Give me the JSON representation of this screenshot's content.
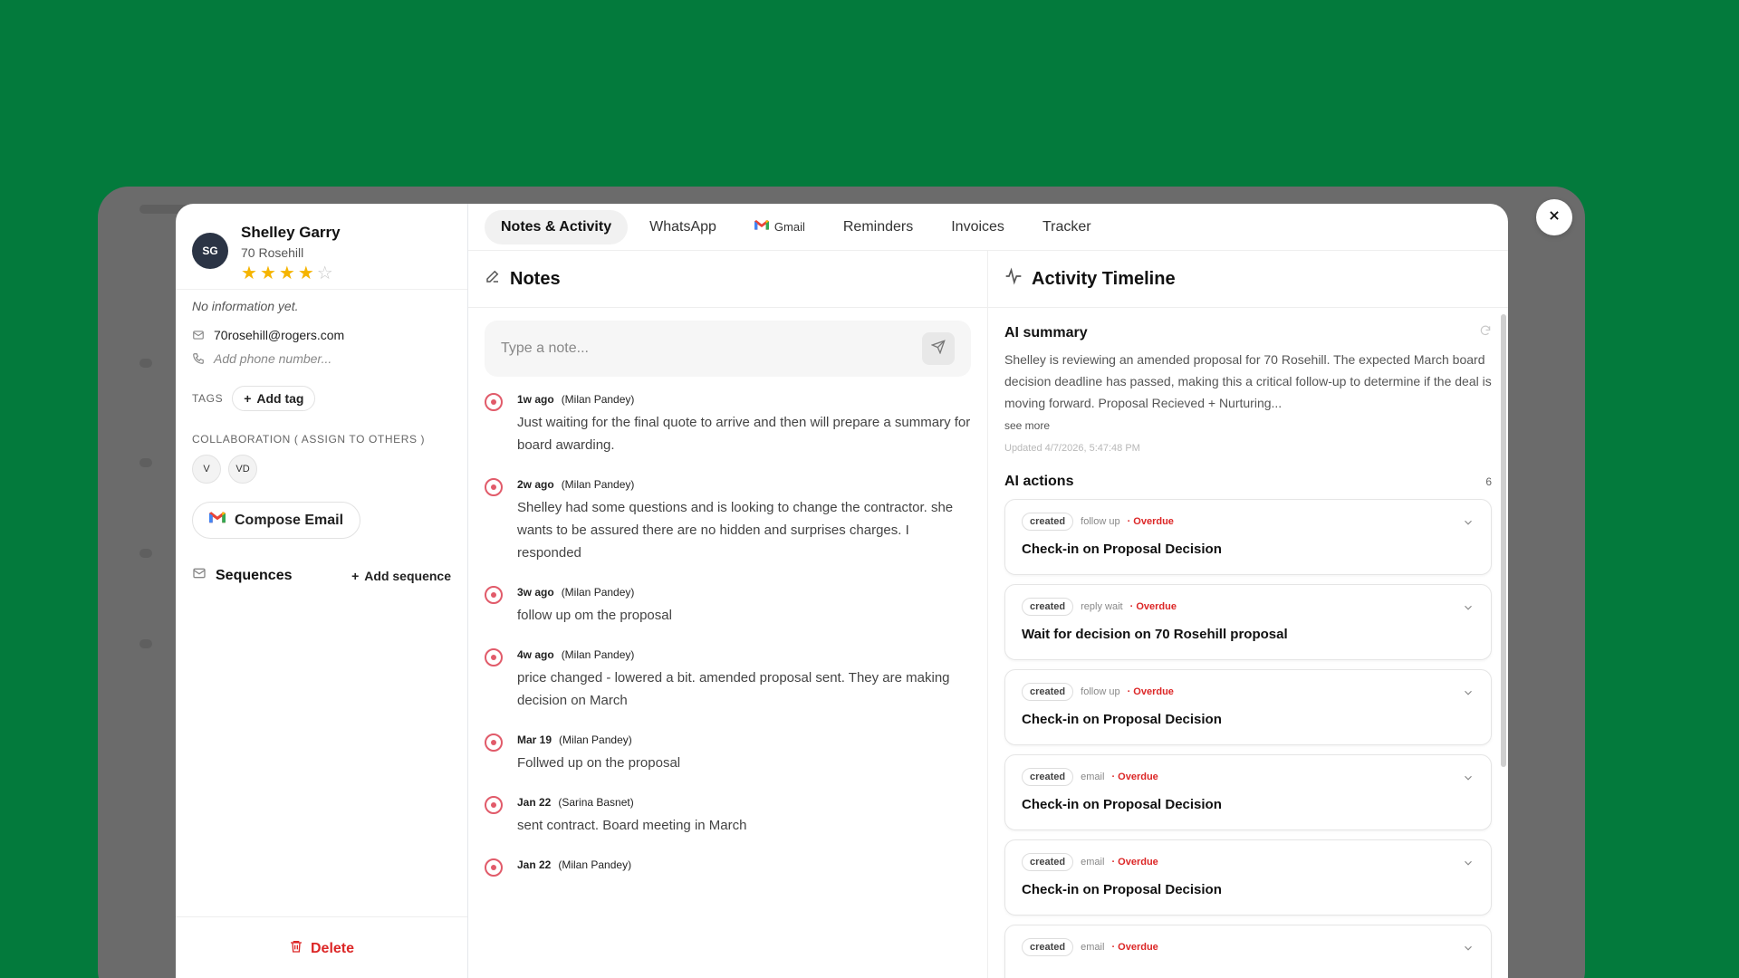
{
  "contact": {
    "initials": "SG",
    "name": "Shelley Garry",
    "subtitle": "70 Rosehill",
    "rating": 4,
    "no_info": "No information yet.",
    "email": "70rosehill@rogers.com",
    "phone_placeholder": "Add phone number..."
  },
  "tags": {
    "label": "TAGS",
    "add_label": "Add tag"
  },
  "collaboration": {
    "label": "COLLABORATION ( ASSIGN TO OTHERS )",
    "members": [
      "V",
      "VD"
    ]
  },
  "compose_label": "Compose Email",
  "sequences": {
    "label": "Sequences",
    "add_label": "Add sequence"
  },
  "delete_label": "Delete",
  "tabs": [
    {
      "label": "Notes & Activity",
      "active": true
    },
    {
      "label": "WhatsApp"
    },
    {
      "label": "Gmail"
    },
    {
      "label": "Reminders"
    },
    {
      "label": "Invoices"
    },
    {
      "label": "Tracker"
    }
  ],
  "notes": {
    "title": "Notes",
    "input_placeholder": "Type a note...",
    "items": [
      {
        "when": "1w ago",
        "author": "(Milan Pandey)",
        "text": "Just waiting for the final quote to arrive and then will prepare a summary for board awarding."
      },
      {
        "when": "2w ago",
        "author": "(Milan Pandey)",
        "text": "Shelley had some questions and is looking to change the contractor. she wants to be assured there are no hidden and surprises charges. I responded"
      },
      {
        "when": "3w ago",
        "author": "(Milan Pandey)",
        "text": "follow up om the proposal"
      },
      {
        "when": "4w ago",
        "author": "(Milan Pandey)",
        "text": "price changed - lowered a bit. amended proposal sent. They are making decision on March"
      },
      {
        "when": "Mar 19",
        "author": "(Milan Pandey)",
        "text": "Follwed up on the proposal"
      },
      {
        "when": "Jan 22",
        "author": "(Sarina Basnet)",
        "text": "sent contract. Board meeting in March"
      },
      {
        "when": "Jan 22",
        "author": "(Milan Pandey)",
        "text": ""
      }
    ]
  },
  "activity": {
    "title": "Activity Timeline",
    "ai_summary_title": "AI summary",
    "ai_summary_text": "Shelley is reviewing an amended proposal for 70 Rosehill. The expected March board decision deadline has passed, making this a critical follow-up to determine if the deal is moving forward. Proposal Recieved + Nurturing...",
    "see_more": "see more",
    "updated": "Updated 4/7/2026, 5:47:48 PM",
    "ai_actions_title": "AI actions",
    "ai_actions_count": "6",
    "actions": [
      {
        "status": "created",
        "kind": "follow up",
        "flag": "· Overdue",
        "title": "Check-in on Proposal Decision"
      },
      {
        "status": "created",
        "kind": "reply wait",
        "flag": "· Overdue",
        "title": "Wait for decision on 70 Rosehill proposal"
      },
      {
        "status": "created",
        "kind": "follow up",
        "flag": "· Overdue",
        "title": "Check-in on Proposal Decision"
      },
      {
        "status": "created",
        "kind": "email",
        "flag": "· Overdue",
        "title": "Check-in on Proposal Decision"
      },
      {
        "status": "created",
        "kind": "email",
        "flag": "· Overdue",
        "title": "Check-in on Proposal Decision"
      },
      {
        "status": "created",
        "kind": "email",
        "flag": "· Overdue",
        "title": ""
      }
    ]
  },
  "colors": {
    "background": "#037a3c",
    "overdue": "#dc2626",
    "star": "#f5b400",
    "note_marker": "#e15b6a"
  }
}
